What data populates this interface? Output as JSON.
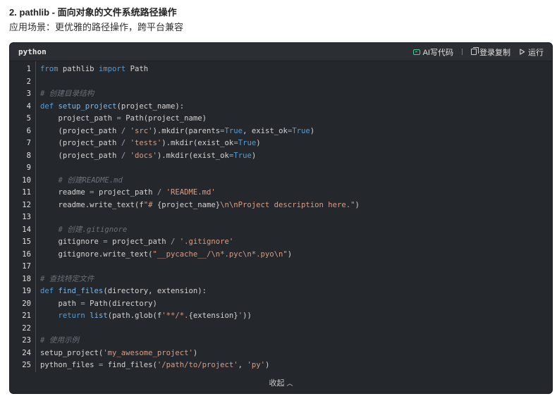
{
  "section": {
    "title": "2. pathlib - 面向对象的文件系统路径操作",
    "subtitle": "应用场景：更优雅的路径操作，跨平台兼容"
  },
  "code_block": {
    "language": "python",
    "actions": {
      "ai_label": "AI写代码",
      "copy_label": "登录复制",
      "run_label": "运行"
    },
    "collapse_label": "收起",
    "lines": [
      [
        {
          "t": "kw",
          "v": "from"
        },
        {
          "t": "p",
          "v": " pathlib "
        },
        {
          "t": "kw",
          "v": "import"
        },
        {
          "t": "p",
          "v": " Path"
        }
      ],
      [],
      [
        {
          "t": "cm",
          "v": "# 创建目录结构"
        }
      ],
      [
        {
          "t": "kw",
          "v": "def"
        },
        {
          "t": "p",
          "v": " "
        },
        {
          "t": "fn",
          "v": "setup_project"
        },
        {
          "t": "p",
          "v": "(project_name):"
        }
      ],
      [
        {
          "t": "p",
          "v": "    project_path "
        },
        {
          "t": "op",
          "v": "="
        },
        {
          "t": "p",
          "v": " Path(project_name)"
        }
      ],
      [
        {
          "t": "p",
          "v": "    (project_path "
        },
        {
          "t": "op",
          "v": "/"
        },
        {
          "t": "p",
          "v": " "
        },
        {
          "t": "str",
          "v": "'src'"
        },
        {
          "t": "p",
          "v": ").mkdir(parents"
        },
        {
          "t": "op",
          "v": "="
        },
        {
          "t": "cst",
          "v": "True"
        },
        {
          "t": "p",
          "v": ", exist_ok"
        },
        {
          "t": "op",
          "v": "="
        },
        {
          "t": "cst",
          "v": "True"
        },
        {
          "t": "p",
          "v": ")"
        }
      ],
      [
        {
          "t": "p",
          "v": "    (project_path "
        },
        {
          "t": "op",
          "v": "/"
        },
        {
          "t": "p",
          "v": " "
        },
        {
          "t": "str",
          "v": "'tests'"
        },
        {
          "t": "p",
          "v": ").mkdir(exist_ok"
        },
        {
          "t": "op",
          "v": "="
        },
        {
          "t": "cst",
          "v": "True"
        },
        {
          "t": "p",
          "v": ")"
        }
      ],
      [
        {
          "t": "p",
          "v": "    (project_path "
        },
        {
          "t": "op",
          "v": "/"
        },
        {
          "t": "p",
          "v": " "
        },
        {
          "t": "str",
          "v": "'docs'"
        },
        {
          "t": "p",
          "v": ").mkdir(exist_ok"
        },
        {
          "t": "op",
          "v": "="
        },
        {
          "t": "cst",
          "v": "True"
        },
        {
          "t": "p",
          "v": ")"
        }
      ],
      [],
      [
        {
          "t": "p",
          "v": "    "
        },
        {
          "t": "cm",
          "v": "# 创建README.md"
        }
      ],
      [
        {
          "t": "p",
          "v": "    readme "
        },
        {
          "t": "op",
          "v": "="
        },
        {
          "t": "p",
          "v": " project_path "
        },
        {
          "t": "op",
          "v": "/"
        },
        {
          "t": "p",
          "v": " "
        },
        {
          "t": "str",
          "v": "'README.md'"
        }
      ],
      [
        {
          "t": "p",
          "v": "    readme.write_text(f"
        },
        {
          "t": "str",
          "v": "\"# "
        },
        {
          "t": "p",
          "v": "{project_name}"
        },
        {
          "t": "str",
          "v": "\\n\\nProject description here.\""
        },
        {
          "t": "p",
          "v": ")"
        }
      ],
      [],
      [
        {
          "t": "p",
          "v": "    "
        },
        {
          "t": "cm",
          "v": "# 创建.gitignore"
        }
      ],
      [
        {
          "t": "p",
          "v": "    gitignore "
        },
        {
          "t": "op",
          "v": "="
        },
        {
          "t": "p",
          "v": " project_path "
        },
        {
          "t": "op",
          "v": "/"
        },
        {
          "t": "p",
          "v": " "
        },
        {
          "t": "str",
          "v": "'.gitignore'"
        }
      ],
      [
        {
          "t": "p",
          "v": "    gitignore.write_text("
        },
        {
          "t": "str",
          "v": "\"__pycache__/\\n*.pyc\\n*.pyo\\n\""
        },
        {
          "t": "p",
          "v": ")"
        }
      ],
      [],
      [
        {
          "t": "cm",
          "v": "# 查找特定文件"
        }
      ],
      [
        {
          "t": "kw",
          "v": "def"
        },
        {
          "t": "p",
          "v": " "
        },
        {
          "t": "fn",
          "v": "find_files"
        },
        {
          "t": "p",
          "v": "(directory, extension):"
        }
      ],
      [
        {
          "t": "p",
          "v": "    path "
        },
        {
          "t": "op",
          "v": "="
        },
        {
          "t": "p",
          "v": " Path(directory)"
        }
      ],
      [
        {
          "t": "p",
          "v": "    "
        },
        {
          "t": "kw",
          "v": "return"
        },
        {
          "t": "p",
          "v": " "
        },
        {
          "t": "fn",
          "v": "list"
        },
        {
          "t": "p",
          "v": "(path.glob(f"
        },
        {
          "t": "str",
          "v": "'**/*."
        },
        {
          "t": "p",
          "v": "{extension}"
        },
        {
          "t": "str",
          "v": "'"
        },
        {
          "t": "p",
          "v": "))"
        }
      ],
      [],
      [
        {
          "t": "cm",
          "v": "# 使用示例"
        }
      ],
      [
        {
          "t": "p",
          "v": "setup_project("
        },
        {
          "t": "str",
          "v": "'my_awesome_project'"
        },
        {
          "t": "p",
          "v": ")"
        }
      ],
      [
        {
          "t": "p",
          "v": "python_files "
        },
        {
          "t": "op",
          "v": "="
        },
        {
          "t": "p",
          "v": " find_files("
        },
        {
          "t": "str",
          "v": "'/path/to/project'"
        },
        {
          "t": "p",
          "v": ", "
        },
        {
          "t": "str",
          "v": "'py'"
        },
        {
          "t": "p",
          "v": ")"
        }
      ]
    ]
  }
}
